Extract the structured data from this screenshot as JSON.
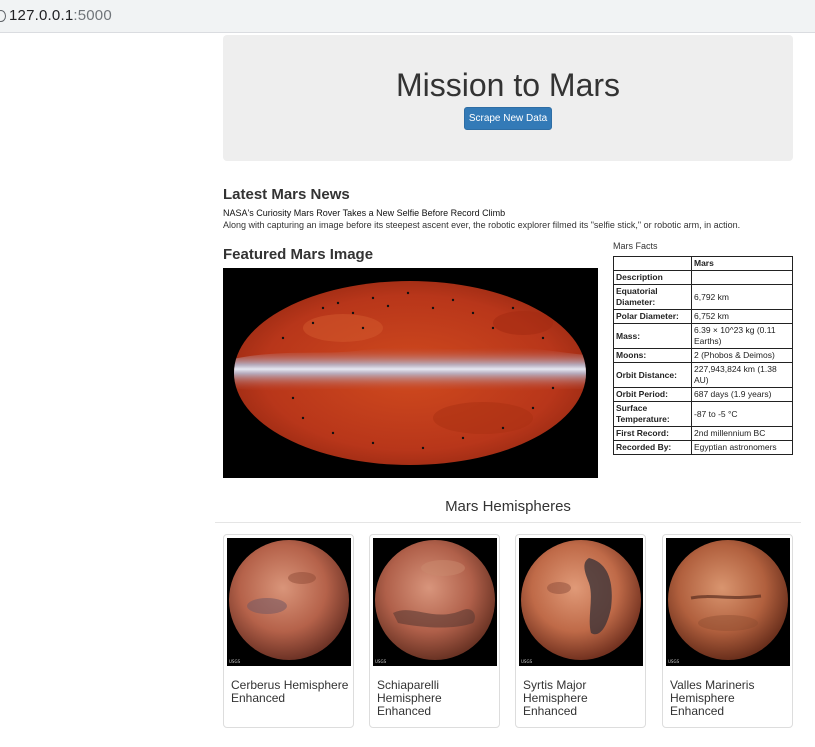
{
  "browser": {
    "url_host": "127.0.0.1",
    "url_port": ":5000"
  },
  "jumbotron": {
    "title": "Mission to Mars",
    "button_label": "Scrape New Data"
  },
  "news": {
    "heading": "Latest Mars News",
    "title": "NASA's Curiosity Mars Rover Takes a New Selfie Before Record Climb",
    "paragraph": "Along with capturing an image before its steepest ascent ever, the robotic explorer filmed its \"selfie stick,\" or robotic arm, in action."
  },
  "featured": {
    "heading": "Featured Mars Image"
  },
  "facts": {
    "label": "Mars Facts",
    "column_header": "Mars",
    "rows": [
      {
        "key": "Description",
        "value": ""
      },
      {
        "key": "Equatorial Diameter:",
        "value": "6,792 km"
      },
      {
        "key": "Polar Diameter:",
        "value": "6,752 km"
      },
      {
        "key": "Mass:",
        "value": "6.39 × 10^23 kg (0.11 Earths)"
      },
      {
        "key": "Moons:",
        "value": "2 (Phobos & Deimos)"
      },
      {
        "key": "Orbit Distance:",
        "value": "227,943,824 km (1.38 AU)"
      },
      {
        "key": "Orbit Period:",
        "value": "687 days (1.9 years)"
      },
      {
        "key": "Surface Temperature:",
        "value": "-87 to -5 °C"
      },
      {
        "key": "First Record:",
        "value": "2nd millennium BC"
      },
      {
        "key": "Recorded By:",
        "value": "Egyptian astronomers"
      }
    ]
  },
  "hemispheres": {
    "heading": "Mars Hemispheres",
    "items": [
      {
        "title": "Cerberus Hemisphere Enhanced"
      },
      {
        "title": "Schiaparelli Hemisphere Enhanced"
      },
      {
        "title": "Syrtis Major Hemisphere Enhanced"
      },
      {
        "title": "Valles Marineris Hemisphere Enhanced"
      }
    ]
  }
}
